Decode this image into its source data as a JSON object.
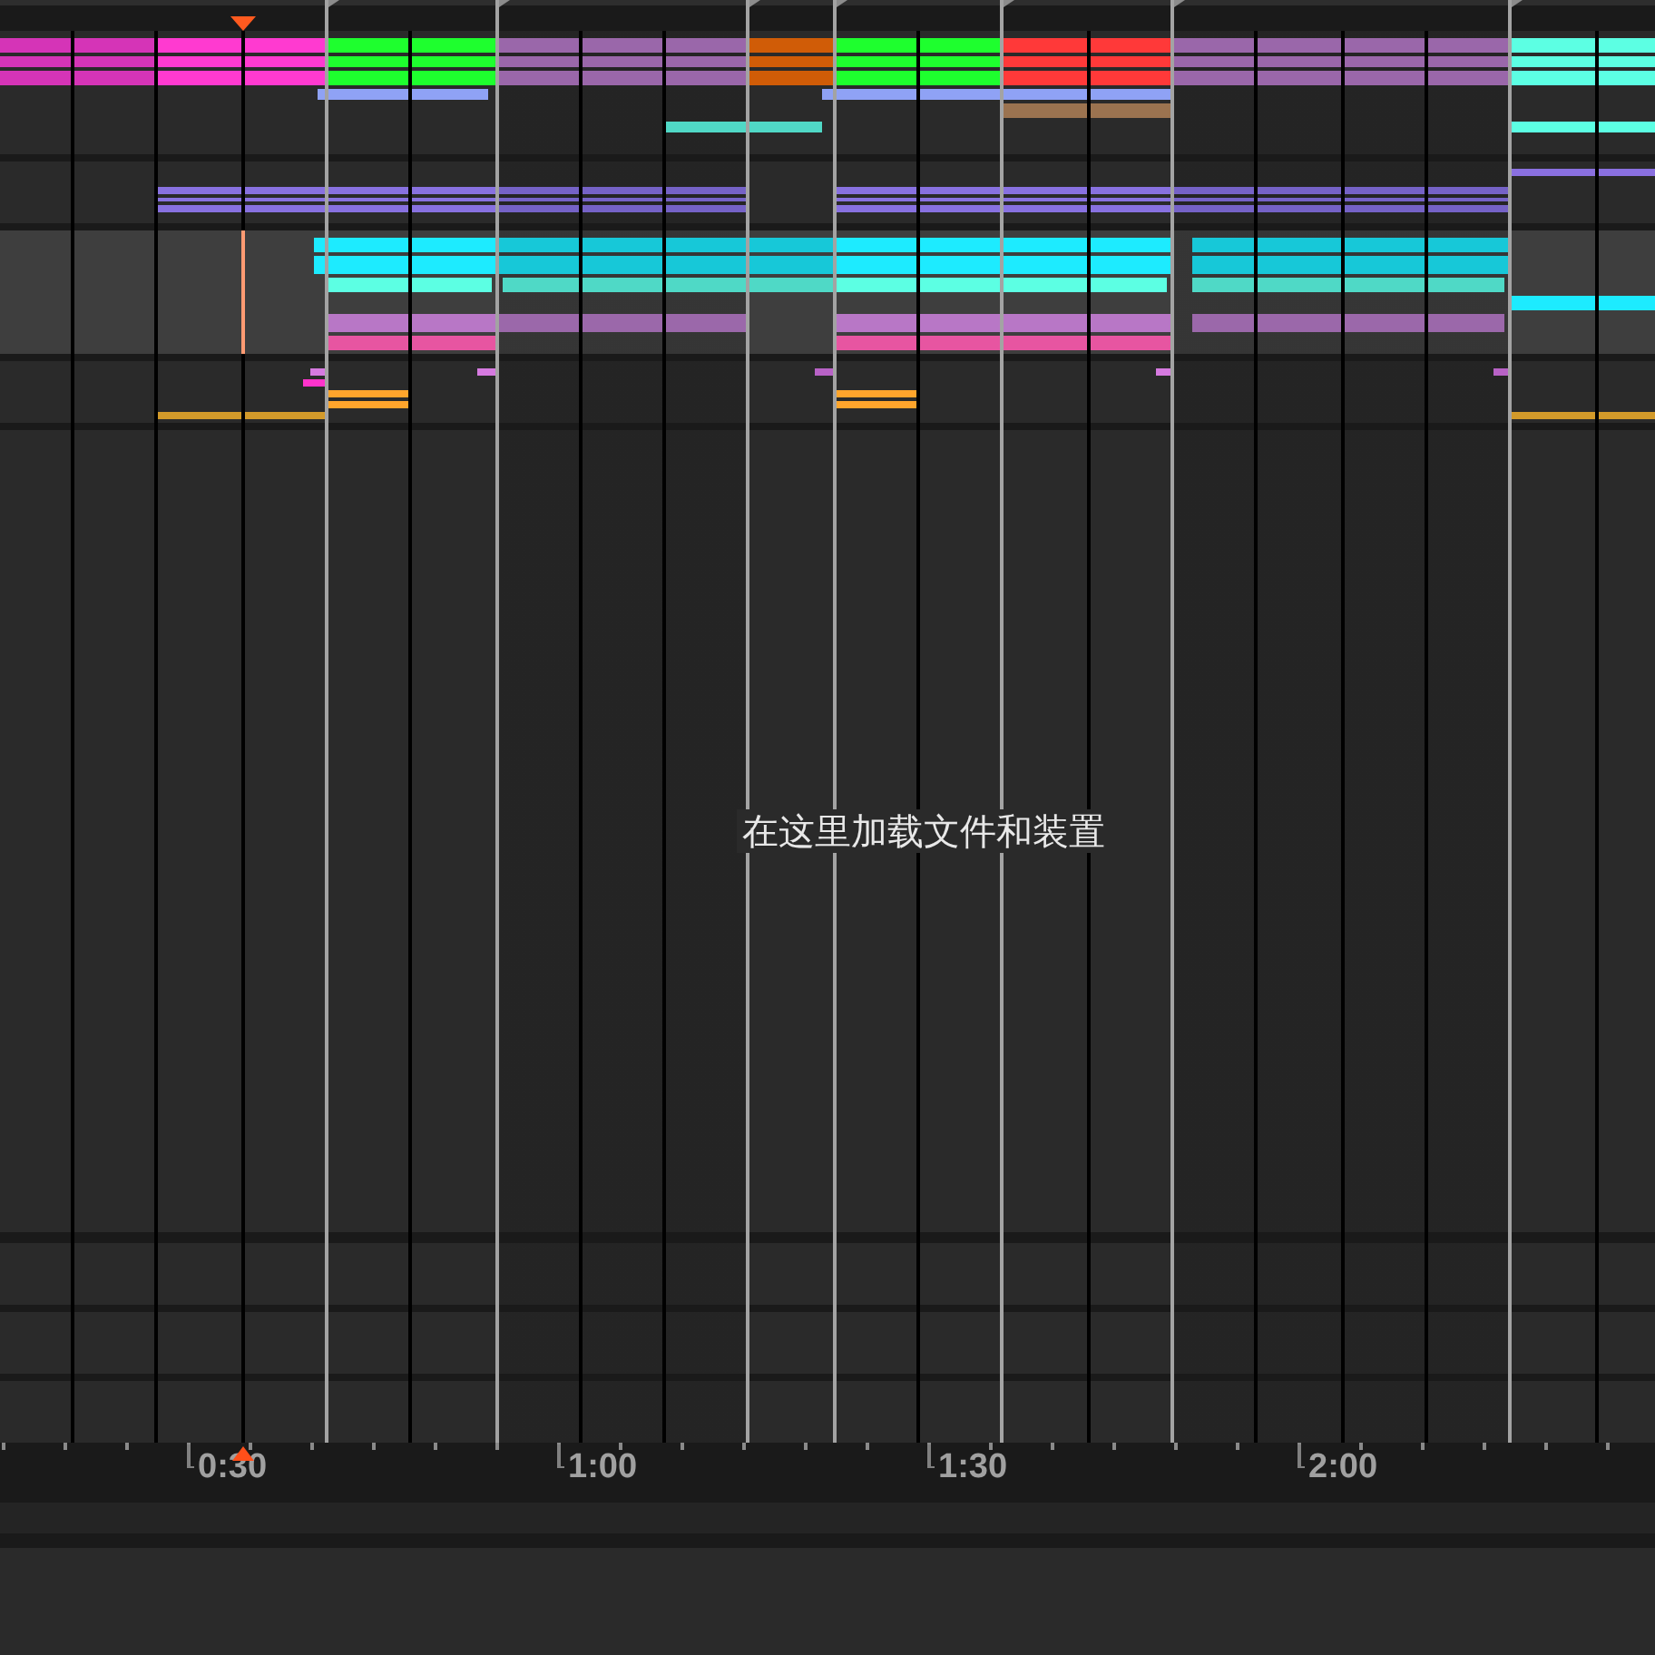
{
  "tracks": [
    {
      "selected": false,
      "clips": [
        {
          "color": "#d534b7"
        },
        {
          "color": "#ff3ad0"
        },
        {
          "color": "#1eff2e"
        },
        {
          "color": "#9a67aa"
        },
        {
          "color": "#d05c07"
        },
        {
          "color": "#1eff2e"
        },
        {
          "color": "#ff3939"
        },
        {
          "color": "#9a67aa"
        },
        {
          "color": "#5cffe3"
        },
        {
          "color": "#8fa2f5"
        },
        {
          "color": "#8fa2f5"
        },
        {
          "color": "#9b7350"
        },
        {
          "color": "#50d8c6"
        },
        {
          "color": "#5cffe3"
        }
      ]
    },
    {
      "selected": false,
      "clips": [
        {
          "color": "#8871e0"
        },
        {
          "color": "#7562c6"
        },
        {
          "color": "#8871e0"
        },
        {
          "color": "#7562c6"
        },
        {
          "color": "#8a70e0"
        }
      ]
    },
    {
      "selected": true,
      "clips": [
        {
          "color": "#1debff"
        },
        {
          "color": "#17c8d8"
        },
        {
          "color": "#1debff"
        },
        {
          "color": "#17c8d8"
        },
        {
          "color": "#1debff"
        },
        {
          "color": "#5cffe3"
        },
        {
          "color": "#4fd9c6"
        },
        {
          "color": "#5cffe3"
        },
        {
          "color": "#4fd9c6"
        },
        {
          "color": "#b877c6"
        },
        {
          "color": "#9b68aa"
        },
        {
          "color": "#b877c6"
        },
        {
          "color": "#9b68aa"
        },
        {
          "color": "#e755a1"
        },
        {
          "color": "#e755a1"
        }
      ]
    },
    {
      "selected": false,
      "clips": [
        {
          "color": "#d67ae0"
        },
        {
          "color": "#d67ae0"
        },
        {
          "color": "#b862c6"
        },
        {
          "color": "#d67ae0"
        },
        {
          "color": "#b862c6"
        },
        {
          "color": "#ff33cc"
        },
        {
          "color": "#ffa52c"
        },
        {
          "color": "#ffa52c"
        },
        {
          "color": "#d39a2a"
        },
        {
          "color": "#d39a2a"
        }
      ]
    }
  ],
  "drop_area": {
    "hint": "在这里加载文件和装置"
  },
  "ruler": {
    "labels": [
      "0:30",
      "1:00",
      "1:30",
      "2:00"
    ]
  }
}
